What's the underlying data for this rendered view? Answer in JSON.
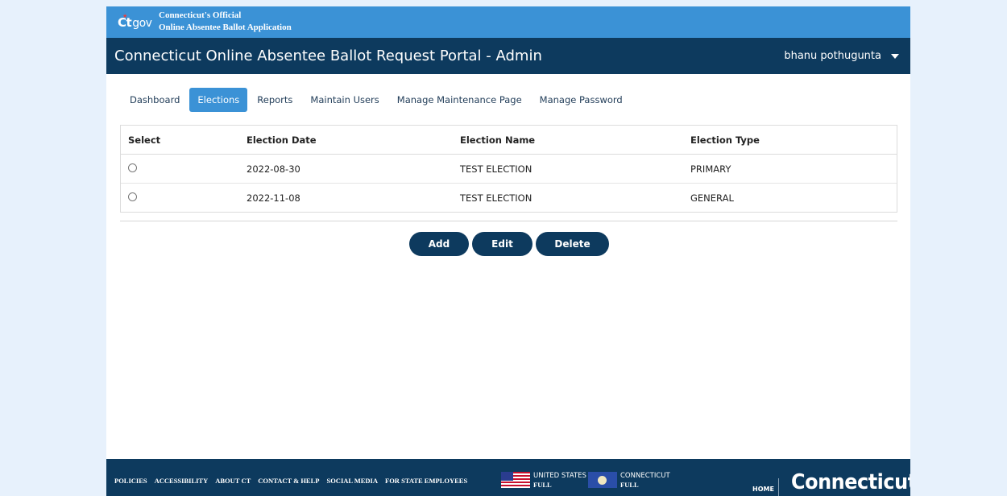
{
  "banner": {
    "logo_ct": "Ct",
    "logo_gov": "gov",
    "line1": "Connecticut's Official",
    "line2": "Online Absentee Ballot Application"
  },
  "header": {
    "title": "Connecticut Online Absentee Ballot Request Portal - Admin",
    "user_name": "bhanu pothugunta"
  },
  "tabs": [
    {
      "label": "Dashboard",
      "active": false
    },
    {
      "label": "Elections",
      "active": true
    },
    {
      "label": "Reports",
      "active": false
    },
    {
      "label": "Maintain Users",
      "active": false
    },
    {
      "label": "Manage Maintenance Page",
      "active": false
    },
    {
      "label": "Manage Password",
      "active": false
    }
  ],
  "table": {
    "columns": [
      "Select",
      "Election Date",
      "Election Name",
      "Election Type"
    ],
    "rows": [
      {
        "date": "2022-08-30",
        "name": "TEST ELECTION",
        "type": "PRIMARY",
        "selected": false
      },
      {
        "date": "2022-11-08",
        "name": "TEST ELECTION",
        "type": "GENERAL",
        "selected": false
      }
    ]
  },
  "actions": {
    "add": "Add",
    "edit": "Edit",
    "delete": "Delete"
  },
  "footer": {
    "links": [
      "POLICIES",
      "ACCESSIBILITY",
      "ABOUT CT",
      "CONTACT & HELP",
      "SOCIAL MEDIA",
      "FOR STATE EMPLOYEES"
    ],
    "us_flag_top": "UNITED STATES",
    "us_flag_bottom": "FULL",
    "ct_flag_top": "CONNECTICUT",
    "ct_flag_bottom": "FULL",
    "home": "HOME",
    "wordmark": "Connecticut"
  },
  "colors": {
    "page_bg": "#e7f1fc",
    "banner_blue": "#3b92d6",
    "navy": "#0d3a5e",
    "active_tab": "#3b92d6"
  }
}
